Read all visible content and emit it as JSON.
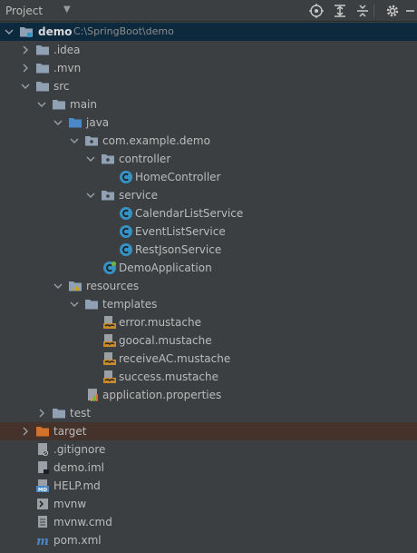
{
  "header": {
    "title": "Project",
    "caret": "▼",
    "icons": [
      "locate-icon",
      "expand-all-icon",
      "collapse-all-icon",
      "gear-icon",
      "minimize-icon"
    ]
  },
  "colors": {
    "background": "#3c3f41",
    "selected_row": "#0d293e",
    "excluded_row": "#45322b",
    "folder": "#8fa1b3",
    "source_folder": "#4a88c7",
    "class_icon": "#3592c4",
    "excluded_folder": "#d3722c"
  },
  "tree": [
    {
      "label": "demo",
      "path": "C:\\SpringBoot\\demo",
      "expanded": true,
      "icon": "module-folder-icon"
    },
    {
      "label": ".idea",
      "expanded": false,
      "icon": "folder-icon"
    },
    {
      "label": ".mvn",
      "expanded": false,
      "icon": "folder-icon"
    },
    {
      "label": "src",
      "expanded": true,
      "icon": "folder-icon"
    },
    {
      "label": "main",
      "expanded": true,
      "icon": "folder-icon"
    },
    {
      "label": "java",
      "expanded": true,
      "icon": "source-folder-icon"
    },
    {
      "label": "com.example.demo",
      "expanded": true,
      "icon": "package-icon"
    },
    {
      "label": "controller",
      "expanded": true,
      "icon": "package-icon"
    },
    {
      "label": "HomeController",
      "icon": "class-icon"
    },
    {
      "label": "service",
      "expanded": true,
      "icon": "package-icon"
    },
    {
      "label": "CalendarListService",
      "icon": "class-icon"
    },
    {
      "label": "EventListService",
      "icon": "class-icon"
    },
    {
      "label": "RestJsonService",
      "icon": "class-icon"
    },
    {
      "label": "DemoApplication",
      "icon": "spring-class-icon"
    },
    {
      "label": "resources",
      "expanded": true,
      "icon": "resources-folder-icon"
    },
    {
      "label": "templates",
      "expanded": true,
      "icon": "folder-icon"
    },
    {
      "label": "error.mustache",
      "icon": "mustache-file-icon"
    },
    {
      "label": "goocal.mustache",
      "icon": "mustache-file-icon"
    },
    {
      "label": "receiveAC.mustache",
      "icon": "mustache-file-icon"
    },
    {
      "label": "success.mustache",
      "icon": "mustache-file-icon"
    },
    {
      "label": "application.properties",
      "icon": "properties-file-icon"
    },
    {
      "label": "test",
      "expanded": false,
      "icon": "folder-icon"
    },
    {
      "label": "target",
      "expanded": false,
      "icon": "excluded-folder-icon"
    },
    {
      "label": ".gitignore",
      "icon": "gitignore-file-icon"
    },
    {
      "label": "demo.iml",
      "icon": "iml-file-icon"
    },
    {
      "label": "HELP.md",
      "icon": "markdown-file-icon"
    },
    {
      "label": "mvnw",
      "icon": "shell-script-icon"
    },
    {
      "label": "mvnw.cmd",
      "icon": "text-file-icon"
    },
    {
      "label": "pom.xml",
      "icon": "maven-icon"
    }
  ]
}
